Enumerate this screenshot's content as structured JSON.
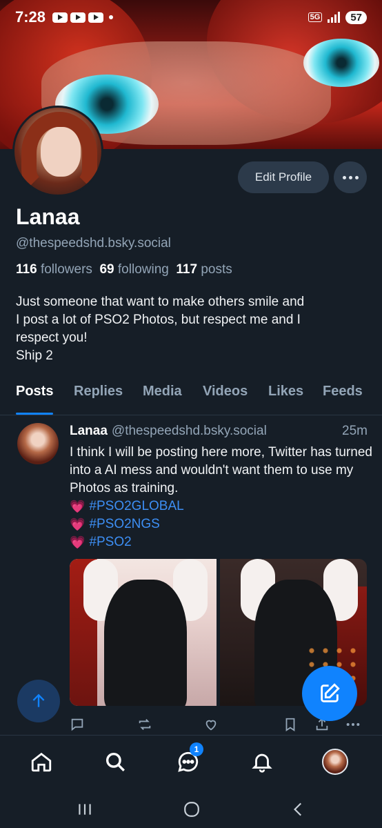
{
  "status_bar": {
    "time": "7:28",
    "network": "5G",
    "battery": "57"
  },
  "profile": {
    "name": "Lanaa",
    "handle": "@thespeedshd.bsky.social",
    "followers_count": "116",
    "followers_label": "followers",
    "following_count": "69",
    "following_label": "following",
    "posts_count": "117",
    "posts_label": "posts",
    "bio": "Just someone that want to make others smile and\nI post a lot of PSO2 Photos, but respect me and I\nrespect you!\nShip 2",
    "edit_button": "Edit Profile"
  },
  "tabs": [
    {
      "label": "Posts",
      "active": true
    },
    {
      "label": "Replies",
      "active": false
    },
    {
      "label": "Media",
      "active": false
    },
    {
      "label": "Videos",
      "active": false
    },
    {
      "label": "Likes",
      "active": false
    },
    {
      "label": "Feeds",
      "active": false
    }
  ],
  "post": {
    "author": "Lanaa",
    "handle": "@thespeedshd.bsky.social",
    "time": "25m",
    "text": "I think I will be posting here more, Twitter has turned into a AI mess and wouldn't want them to use my Photos as training.",
    "tags": [
      "#PSO2GLOBAL",
      "#PSO2NGS",
      "#PSO2"
    ],
    "tag_emoji": "💗"
  },
  "nav": {
    "messages_badge": "1"
  },
  "colors": {
    "background": "#161e27",
    "accent": "#1083fe",
    "muted_text": "#93a5b7",
    "button_bg": "#2c3a4a",
    "tag_color": "#3d8ff5"
  }
}
